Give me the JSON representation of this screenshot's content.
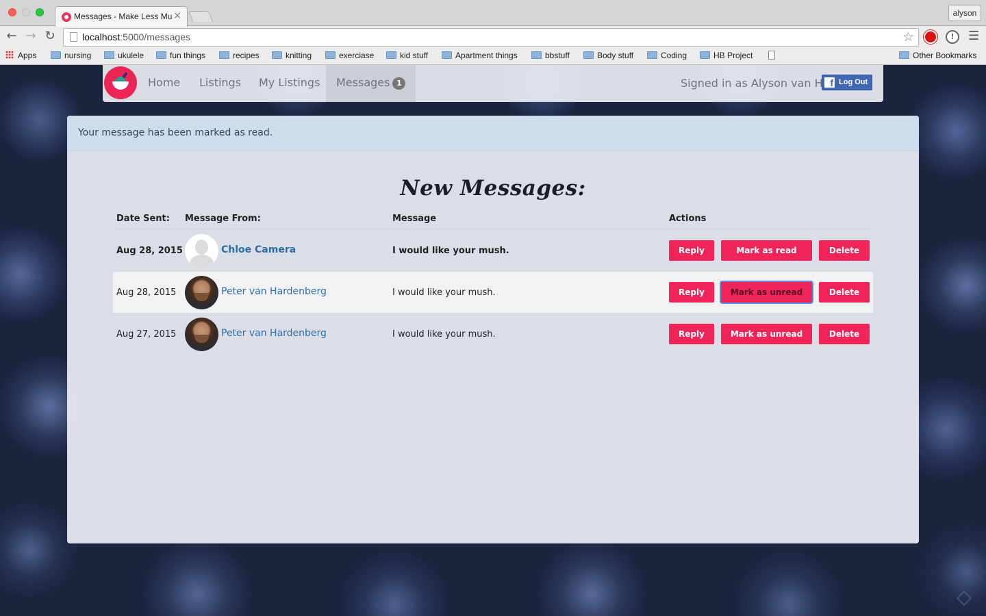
{
  "browser": {
    "tab_title": "Messages - Make Less Mu",
    "tab_close": "×",
    "profile": "alyson",
    "url_host": "localhost",
    "url_path": ":5000/messages",
    "bookmarks": [
      {
        "label": "Apps",
        "icon": "apps-icon"
      },
      {
        "label": "nursing",
        "icon": "folder-icon"
      },
      {
        "label": "ukulele",
        "icon": "folder-icon"
      },
      {
        "label": "fun things",
        "icon": "folder-icon"
      },
      {
        "label": "recipes",
        "icon": "folder-icon"
      },
      {
        "label": "knitting",
        "icon": "folder-icon"
      },
      {
        "label": "exerciase",
        "icon": "folder-icon"
      },
      {
        "label": "kid stuff",
        "icon": "folder-icon"
      },
      {
        "label": "Apartment things",
        "icon": "folder-icon"
      },
      {
        "label": "bbstuff",
        "icon": "folder-icon"
      },
      {
        "label": "Body stuff",
        "icon": "folder-icon"
      },
      {
        "label": "Coding",
        "icon": "folder-icon"
      },
      {
        "label": "HB Project",
        "icon": "folder-icon"
      }
    ],
    "other_bookmarks": "Other Bookmarks"
  },
  "nav": {
    "links": [
      "Home",
      "Listings",
      "My Listings"
    ],
    "messages_label": "Messages",
    "messages_badge": "1",
    "signed_in": "Signed in as Alyson van H",
    "logout_label": "Log Out",
    "fb_icon": "f"
  },
  "alert": {
    "text": "Your message has been marked as read."
  },
  "heading": "New Messages:",
  "table": {
    "headers": {
      "date": "Date Sent:",
      "from": "Message From:",
      "message": "Message",
      "actions": "Actions"
    },
    "rows": [
      {
        "date": "Aug 28, 2015",
        "sender": "Chloe Camera",
        "message": "I would like your mush.",
        "reply": "Reply",
        "mark": "Mark as read",
        "delete": "Delete"
      },
      {
        "date": "Aug 28, 2015",
        "sender": "Peter van Hardenberg",
        "message": "I would like your mush.",
        "reply": "Reply",
        "mark": "Mark as unread",
        "delete": "Delete"
      },
      {
        "date": "Aug 27, 2015",
        "sender": "Peter van Hardenberg",
        "message": "I would like your mush.",
        "reply": "Reply",
        "mark": "Mark as unread",
        "delete": "Delete"
      }
    ]
  },
  "colors": {
    "accent": "#f1245a",
    "link": "#2d6ea8",
    "facebook": "#4267b2"
  }
}
